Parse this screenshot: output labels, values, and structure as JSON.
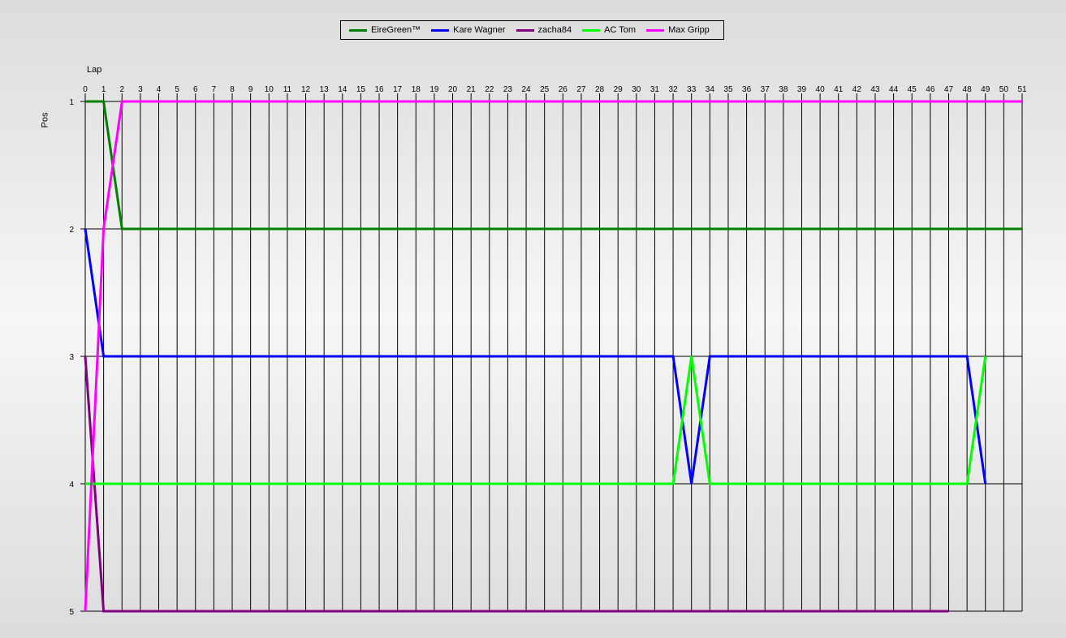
{
  "chart_data": {
    "type": "line",
    "xlabel": "Lap",
    "ylabel": "Pos",
    "xlim": [
      0,
      51
    ],
    "ylim": [
      1,
      5
    ],
    "y_inverted": true,
    "x_ticks": [
      0,
      1,
      2,
      3,
      4,
      5,
      6,
      7,
      8,
      9,
      10,
      11,
      12,
      13,
      14,
      15,
      16,
      17,
      18,
      19,
      20,
      21,
      22,
      23,
      24,
      25,
      26,
      27,
      28,
      29,
      30,
      31,
      32,
      33,
      34,
      35,
      36,
      37,
      38,
      39,
      40,
      41,
      42,
      43,
      44,
      45,
      46,
      47,
      48,
      49,
      50,
      51
    ],
    "y_ticks": [
      1,
      2,
      3,
      4,
      5
    ],
    "grid": {
      "vertical": true,
      "horizontal": true
    },
    "legend_position": "top",
    "series": [
      {
        "name": "EireGreen™",
        "color": "#008000",
        "points": [
          [
            0,
            1
          ],
          [
            1,
            1
          ],
          [
            2,
            2
          ],
          [
            51,
            2
          ]
        ]
      },
      {
        "name": "Kare Wagner",
        "color": "#0000ff",
        "points": [
          [
            0,
            2
          ],
          [
            1,
            3
          ],
          [
            32,
            3
          ],
          [
            33,
            4
          ],
          [
            34,
            3
          ],
          [
            48,
            3
          ],
          [
            49,
            4
          ]
        ]
      },
      {
        "name": "zacha84",
        "color": "#800080",
        "points": [
          [
            0,
            3
          ],
          [
            1,
            5
          ],
          [
            47,
            5
          ]
        ]
      },
      {
        "name": "AC Tom",
        "color": "#00ff00",
        "points": [
          [
            0,
            4
          ],
          [
            32,
            4
          ],
          [
            33,
            3
          ],
          [
            34,
            4
          ],
          [
            48,
            4
          ],
          [
            49,
            3
          ]
        ]
      },
      {
        "name": "Max Gripp",
        "color": "#ff00ff",
        "points": [
          [
            0,
            5
          ],
          [
            1,
            2
          ],
          [
            2,
            1
          ],
          [
            51,
            1
          ]
        ]
      }
    ]
  }
}
